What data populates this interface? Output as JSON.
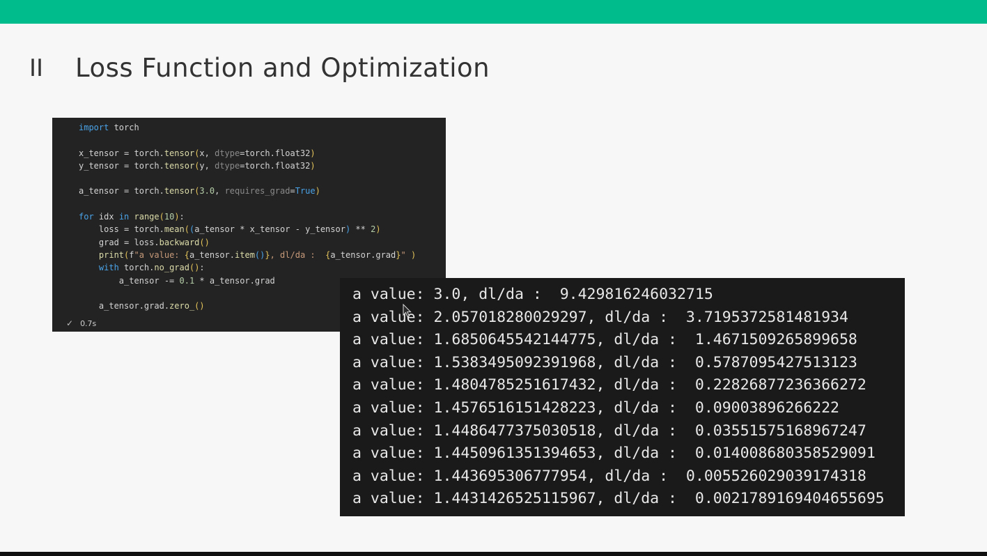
{
  "slide": {
    "section_number": "II",
    "title": "Loss Function and Optimization"
  },
  "code_cell": {
    "lines": [
      [
        [
          "kw",
          "import"
        ],
        [
          "",
          " torch"
        ]
      ],
      [],
      [
        [
          "",
          "x_tensor = torch."
        ],
        [
          "fn",
          "tensor"
        ],
        [
          "par",
          "("
        ],
        [
          "",
          "x, "
        ],
        [
          "prm",
          "dtype"
        ],
        [
          "",
          "=torch.float32"
        ],
        [
          "par",
          ")"
        ]
      ],
      [
        [
          "",
          "y_tensor = torch."
        ],
        [
          "fn",
          "tensor"
        ],
        [
          "par",
          "("
        ],
        [
          "",
          "y, "
        ],
        [
          "prm",
          "dtype"
        ],
        [
          "",
          "=torch.float32"
        ],
        [
          "par",
          ")"
        ]
      ],
      [],
      [
        [
          "",
          "a_tensor = torch."
        ],
        [
          "fn",
          "tensor"
        ],
        [
          "par",
          "("
        ],
        [
          "num",
          "3.0"
        ],
        [
          "",
          ", "
        ],
        [
          "prm",
          "requires_grad"
        ],
        [
          "",
          "="
        ],
        [
          "bool",
          "True"
        ],
        [
          "par",
          ")"
        ]
      ],
      [],
      [
        [
          "kw",
          "for"
        ],
        [
          "",
          " idx "
        ],
        [
          "kw",
          "in"
        ],
        [
          "",
          " "
        ],
        [
          "fn",
          "range"
        ],
        [
          "par",
          "("
        ],
        [
          "num",
          "10"
        ],
        [
          "par",
          ")"
        ],
        [
          "",
          ":"
        ]
      ],
      [
        [
          "",
          "    loss = torch."
        ],
        [
          "fn",
          "mean"
        ],
        [
          "par",
          "("
        ],
        [
          "kw",
          "("
        ],
        [
          "",
          "a_tensor * x_tensor - y_tensor"
        ],
        [
          "kw",
          ")"
        ],
        [
          "",
          " ** "
        ],
        [
          "num",
          "2"
        ],
        [
          "par",
          ")"
        ]
      ],
      [
        [
          "",
          "    grad = loss."
        ],
        [
          "fn",
          "backward"
        ],
        [
          "par",
          "()"
        ]
      ],
      [
        [
          "",
          "    "
        ],
        [
          "fn",
          "print"
        ],
        [
          "par",
          "("
        ],
        [
          "",
          "f"
        ],
        [
          "str",
          "\"a value: "
        ],
        [
          "par",
          "{"
        ],
        [
          "",
          "a_tensor."
        ],
        [
          "fn",
          "item"
        ],
        [
          "kw",
          "()"
        ],
        [
          "par",
          "}"
        ],
        [
          "str",
          ", dl/da :  "
        ],
        [
          "par",
          "{"
        ],
        [
          "",
          "a_tensor.grad"
        ],
        [
          "par",
          "}"
        ],
        [
          "str",
          "\" "
        ],
        [
          "par",
          ")"
        ]
      ],
      [
        [
          "",
          "    "
        ],
        [
          "kw",
          "with"
        ],
        [
          "",
          " torch."
        ],
        [
          "fn",
          "no_grad"
        ],
        [
          "par",
          "()"
        ],
        [
          "",
          ":"
        ]
      ],
      [
        [
          "",
          "        a_tensor -= "
        ],
        [
          "num",
          "0.1"
        ],
        [
          "",
          " * a_tensor.grad"
        ]
      ],
      [],
      [
        [
          "",
          "    a_tensor.grad."
        ],
        [
          "fn",
          "zero_"
        ],
        [
          "par",
          "()"
        ]
      ]
    ],
    "exec_time": "0.7s"
  },
  "output": {
    "lines": [
      "a value: 3.0, dl/da :  9.429816246032715",
      "a value: 2.057018280029297, dl/da :  3.7195372581481934",
      "a value: 1.6850645542144775, dl/da :  1.4671509265899658",
      "a value: 1.5383495092391968, dl/da :  0.5787095427513123",
      "a value: 1.4804785251617432, dl/da :  0.22826877236366272",
      "a value: 1.4576516151428223, dl/da :  0.09003896266222",
      "a value: 1.4486477375030518, dl/da :  0.03551575168967247",
      "a value: 1.4450961351394653, dl/da :  0.014008680358529091",
      "a value: 1.443695306777954, dl/da :  0.005526029039174318",
      "a value: 1.4431426525115967, dl/da :  0.0021789169404655695"
    ]
  },
  "colors": {
    "accent_bar": "#00bc8c",
    "code_bg": "#232323",
    "output_bg": "#1a1a1a"
  },
  "icons": {
    "status": "check-icon",
    "pointer": "mouse-cursor-icon"
  }
}
